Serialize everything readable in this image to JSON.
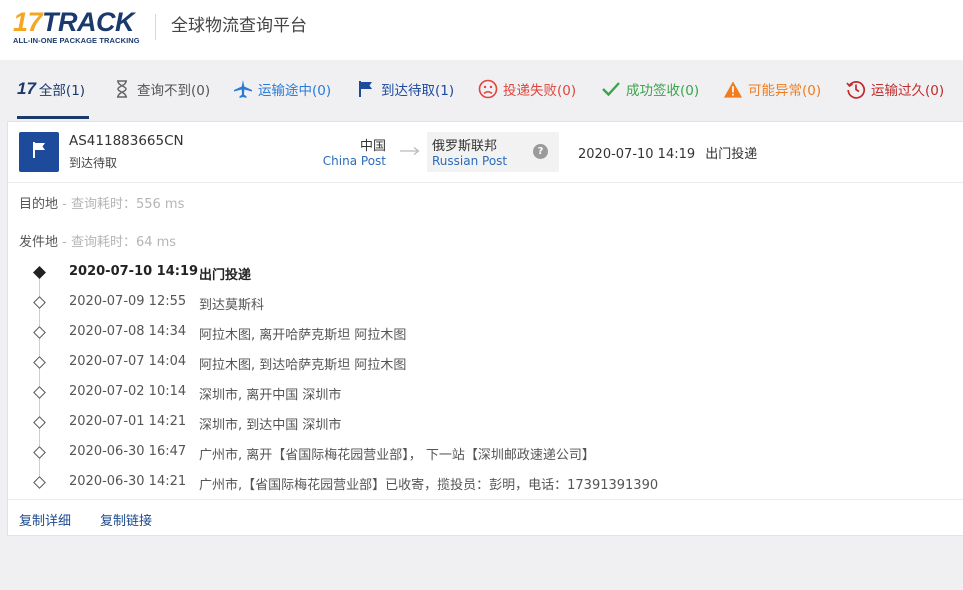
{
  "header": {
    "logo_number": "17",
    "logo_word": "TRACK",
    "logo_tagline": "ALL-IN-ONE PACKAGE TRACKING",
    "site_title": "全球物流查询平台"
  },
  "tabs": [
    {
      "label": "全部(1)",
      "icon": "17track-icon",
      "color": "#1a3a6e"
    },
    {
      "label": "查询不到(0)",
      "icon": "hourglass-icon",
      "color": "#555555"
    },
    {
      "label": "运输途中(0)",
      "icon": "airplane-icon",
      "color": "#2b7bd6"
    },
    {
      "label": "到达待取(1)",
      "icon": "flag-icon",
      "color": "#1e4a9c"
    },
    {
      "label": "投递失败(0)",
      "icon": "sad-face-icon",
      "color": "#e0453a"
    },
    {
      "label": "成功签收(0)",
      "icon": "checkmark-icon",
      "color": "#3aa44a"
    },
    {
      "label": "可能异常(0)",
      "icon": "warning-icon",
      "color": "#f07c1e"
    },
    {
      "label": "运输过久(0)",
      "icon": "history-clock-icon",
      "color": "#c02b2b"
    }
  ],
  "shipment": {
    "tracking_number": "AS411883665CN",
    "status": "到达待取",
    "origin_country": "中国",
    "origin_carrier": "China Post",
    "dest_country": "俄罗斯联邦",
    "dest_carrier": "Russian Post",
    "help_glyph": "?",
    "latest_time": "2020-07-10 14:19",
    "latest_desc": "出门投递"
  },
  "sections": {
    "destination_label": "目的地",
    "destination_meta": " - 查询耗时：556 ms",
    "origin_label": "发件地",
    "origin_meta": " - 查询耗时：64 ms"
  },
  "events": [
    {
      "time": "2020-07-10 14:19",
      "desc": "出门投递"
    },
    {
      "time": "2020-07-09 12:55",
      "desc": "到达莫斯科"
    },
    {
      "time": "2020-07-08 14:34",
      "desc": "阿拉木图, 离开哈萨克斯坦 阿拉木图"
    },
    {
      "time": "2020-07-07 14:04",
      "desc": "阿拉木图, 到达哈萨克斯坦 阿拉木图"
    },
    {
      "time": "2020-07-02 10:14",
      "desc": "深圳市, 离开中国 深圳市"
    },
    {
      "time": "2020-07-01 14:21",
      "desc": "深圳市, 到达中国 深圳市"
    },
    {
      "time": "2020-06-30 16:47",
      "desc": "广州市, 离开【省国际梅花园营业部】， 下一站【深圳邮政速递公司】"
    },
    {
      "time": "2020-06-30 14:21",
      "desc": "广州市,【省国际梅花园营业部】已收寄，揽投员：彭明，电话：17391391390"
    }
  ],
  "footer": {
    "copy_details": "复制详细",
    "copy_link": "复制链接"
  }
}
